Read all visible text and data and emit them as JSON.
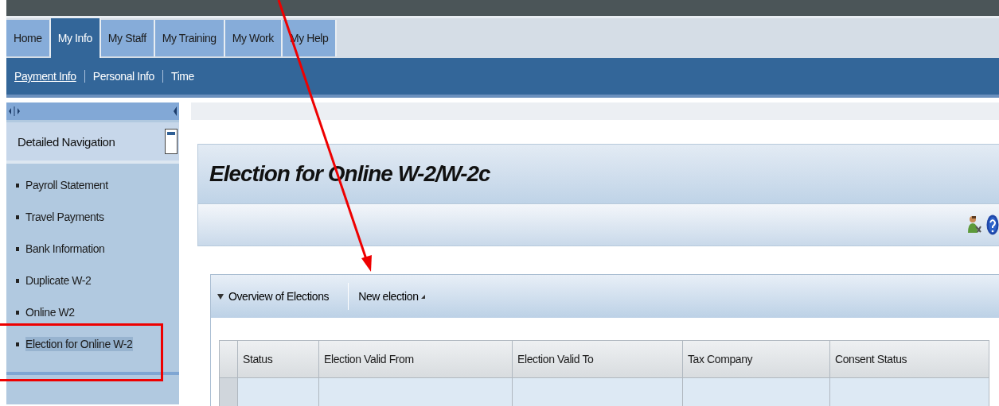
{
  "top_tabs": [
    {
      "label": "Home",
      "selected": false
    },
    {
      "label": "My Info",
      "selected": true
    },
    {
      "label": "My Staff",
      "selected": false
    },
    {
      "label": "My Training",
      "selected": false
    },
    {
      "label": "My Work",
      "selected": false
    },
    {
      "label": "My Help",
      "selected": false
    }
  ],
  "sub_nav": [
    {
      "label": "Payment Info",
      "selected": true
    },
    {
      "label": "Personal Info",
      "selected": false
    },
    {
      "label": "Time",
      "selected": false
    }
  ],
  "sidebar": {
    "title": "Detailed Navigation",
    "items": [
      {
        "label": "Payroll Statement",
        "selected": false
      },
      {
        "label": "Travel Payments",
        "selected": false
      },
      {
        "label": "Bank Information",
        "selected": false
      },
      {
        "label": "Duplicate W-2",
        "selected": false
      },
      {
        "label": "Online W2",
        "selected": false
      },
      {
        "label": "Election for Online W-2",
        "selected": true
      }
    ]
  },
  "page_title": "Election for Online W-2/W-2c",
  "panel": {
    "title": "Overview of Elections",
    "expanded": true,
    "action": "New election"
  },
  "table": {
    "columns": [
      "Status",
      "Election Valid From",
      "Election Valid To",
      "Tax Company",
      "Consent Status"
    ]
  },
  "annotations": {
    "arrow": true,
    "highlight_box": true
  }
}
